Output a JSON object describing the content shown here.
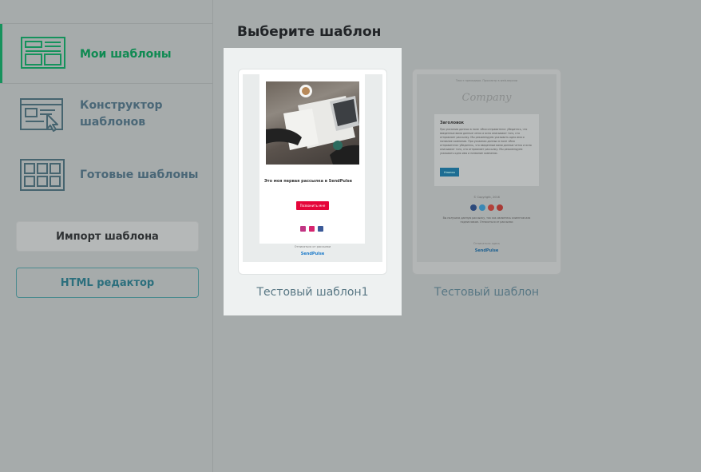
{
  "sidebar": {
    "items": [
      {
        "label": "Мои шаблоны",
        "active": true
      },
      {
        "label": "Конструктор\nшаблонов",
        "active": false
      },
      {
        "label": "Готовые шаблоны",
        "active": false
      }
    ],
    "import_button": "Импорт шаблона",
    "html_button": "HTML редактор"
  },
  "main": {
    "title": "Выберите шаблон",
    "templates": [
      {
        "name": "Тестовый шаблон1",
        "selected": true,
        "preview": {
          "heading": "Это моя первая рассылка в SendPulse",
          "button": "Позвонить мне",
          "footer": "Отписаться от рассылки",
          "brand": "SendPulse"
        }
      },
      {
        "name": "Тестовый шаблон",
        "selected": false,
        "preview": {
          "top": "Текст прехедера. Просмотр в web-версии",
          "logo": "Company",
          "heading": "Заголовок",
          "body": "При указании данных в поле «Имя отправителя» убедитесь, что введенные вами данные четко и ясно описывают того, кто отправляет рассылку. Мы рекомендуем указывать одно имя и название компании. При указании данных в поле «Имя отправителя» убедитесь, что введенные вами данные четко и ясно описывают того, кто отправляет рассылку. Мы рекомендуем указывать одно имя и название компании.",
          "button": "Кнопка",
          "copyright": "© Copyright, 2016",
          "note": "Вы получили данную рассылку, так как являетесь клиентом или подписчиком. Отписаться от рассылки",
          "footer": "Отписаться здесь",
          "brand": "SendPulse"
        }
      }
    ]
  },
  "colors": {
    "accent_green": "#0f8a52",
    "link_teal": "#2c6f7d",
    "preview_button_red": "#e5063a"
  }
}
